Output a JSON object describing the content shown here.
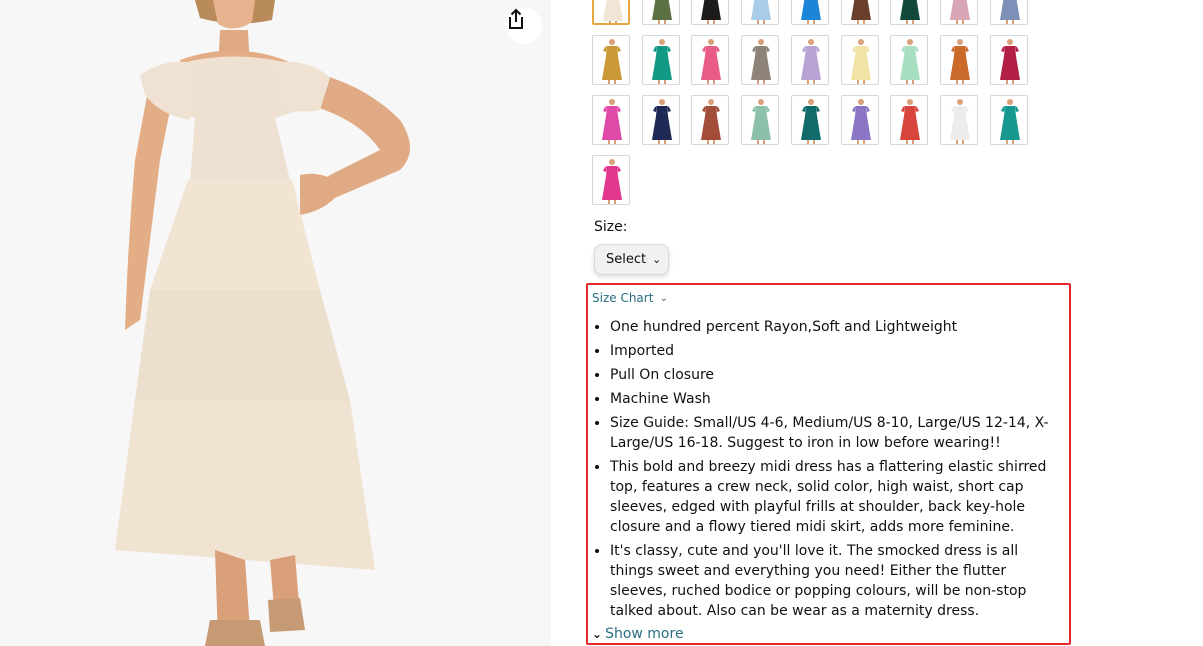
{
  "product": {
    "main_image_alt": "",
    "share_icon": "share-icon"
  },
  "colors": {
    "swatches": [
      "#f3e5d6",
      "#5d7044",
      "#1c1c1c",
      "#a9cde8",
      "#1d85d8",
      "#6a3e2c",
      "#12493a",
      "#d8a6b4",
      "#7f90b8",
      "#c99a35",
      "#129a86",
      "#e95c86",
      "#8e8378",
      "#b8a3d4",
      "#f1e2a6",
      "#a8dfc3",
      "#c96a2a",
      "#b31e46",
      "#e04aa8",
      "#1f2955",
      "#a14d3a",
      "#8dc0aa",
      "#126b6b",
      "#8a76c4",
      "#d8453c",
      "#ececec",
      "#18998f",
      "#e2378f"
    ],
    "selected_index": 0
  },
  "size": {
    "label": "Size:",
    "select_value": "Select"
  },
  "details": {
    "size_chart_label": "Size Chart",
    "bullets": [
      "One hundred percent Rayon,Soft and Lightweight",
      "Imported",
      "Pull On closure",
      "Machine Wash",
      "Size Guide: Small/US 4-6, Medium/US 8-10, Large/US 12-14, X-Large/US 16-18. Suggest to iron in low before wearing!!",
      "This bold and breezy midi dress has a flattering elastic shirred top, features a crew neck, solid color, high waist, short cap sleeves, edged with playful frills at shoulder, back key-hole closure and a flowy tiered midi skirt, adds more feminine.",
      "It's classy, cute and you'll love it. The smocked dress is all things sweet and everything you need! Either the flutter sleeves, ruched bodice or popping colours, will be non-stop talked about. Also can be wear as a maternity dress."
    ],
    "show_more_label": "Show more"
  },
  "accent": {
    "link": "#2a6f82",
    "highlight_border": "#e22a2a",
    "selected_swatch_border": "#e7a93d"
  }
}
